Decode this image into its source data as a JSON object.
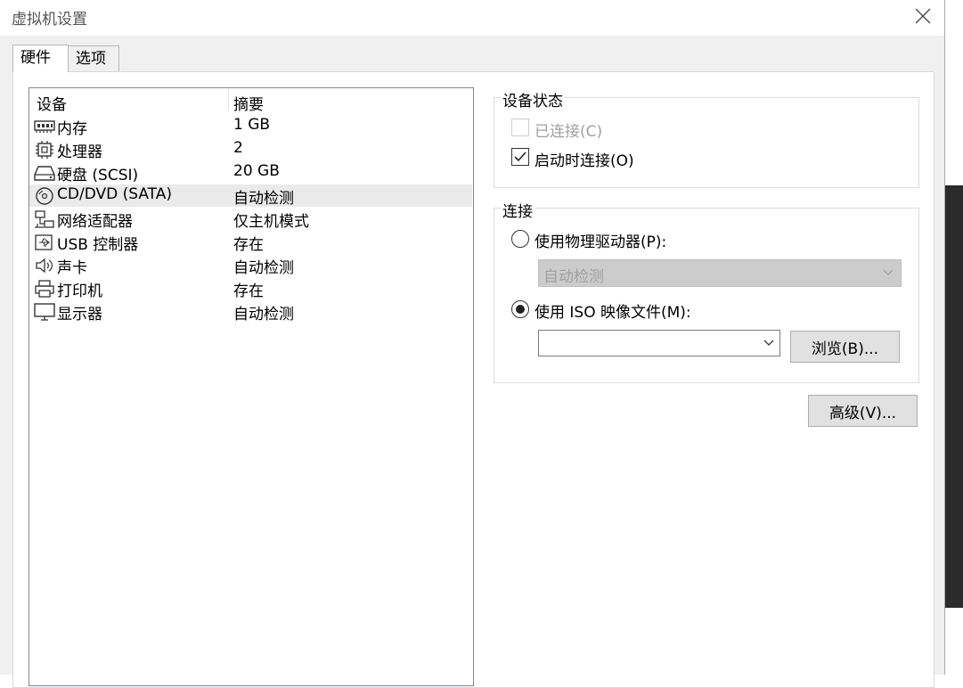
{
  "window": {
    "title": "虚拟机设置"
  },
  "tabs": [
    {
      "label": "硬件"
    },
    {
      "label": "选项"
    }
  ],
  "device_list": {
    "columns": [
      "设备",
      "摘要"
    ],
    "rows": [
      {
        "name": "内存",
        "summary": "1 GB",
        "icon": "memory-icon"
      },
      {
        "name": "处理器",
        "summary": "2",
        "icon": "processor-icon"
      },
      {
        "name": "硬盘 (SCSI)",
        "summary": "20 GB",
        "icon": "harddisk-icon"
      },
      {
        "name": "CD/DVD (SATA)",
        "summary": "自动检测",
        "icon": "cd-dvd-icon",
        "selected": true
      },
      {
        "name": "网络适配器",
        "summary": "仅主机模式",
        "icon": "network-adapter-icon"
      },
      {
        "name": "USB 控制器",
        "summary": "存在",
        "icon": "usb-icon"
      },
      {
        "name": "声卡",
        "summary": "自动检测",
        "icon": "sound-card-icon"
      },
      {
        "name": "打印机",
        "summary": "存在",
        "icon": "printer-icon"
      },
      {
        "name": "显示器",
        "summary": "自动检测",
        "icon": "display-icon"
      }
    ]
  },
  "device_status": {
    "label": "设备状态",
    "connected": {
      "label": "已连接(C)",
      "checked": false,
      "disabled": true
    },
    "connect_at_power_on": {
      "label": "启动时连接(O)",
      "checked": true
    }
  },
  "connection": {
    "label": "连接",
    "physical_drive": {
      "label": "使用物理驱动器(P):",
      "selected": false,
      "value": "自动检测"
    },
    "iso_image": {
      "label": "使用 ISO 映像文件(M):",
      "selected": true,
      "value": ""
    },
    "browse_label": "浏览(B)..."
  },
  "advanced_label": "高级(V)..."
}
